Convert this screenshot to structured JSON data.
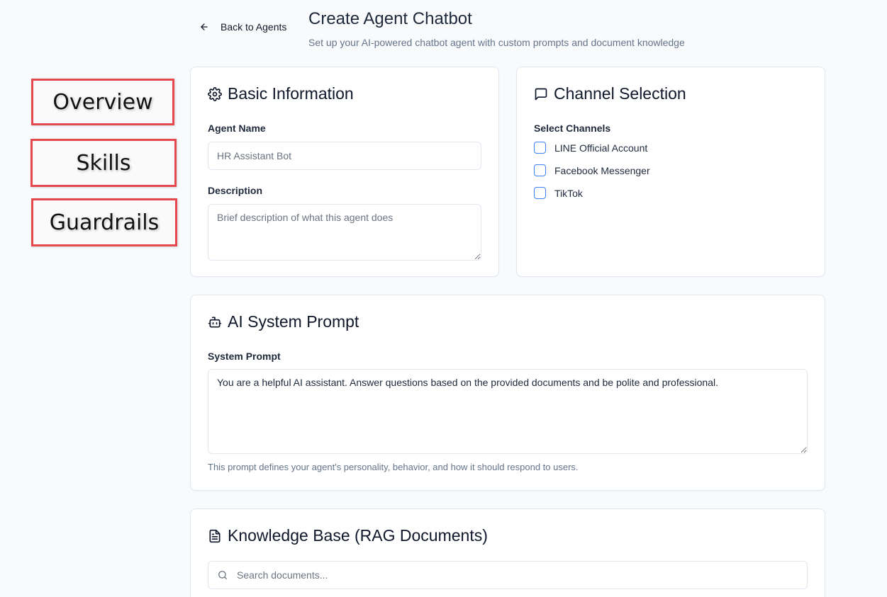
{
  "nav": {
    "overview": "Overview",
    "skills": "Skills",
    "guardrails": "Guardrails"
  },
  "header": {
    "back_label": "Back to Agents",
    "title": "Create Agent Chatbot",
    "subtitle": "Set up your AI-powered chatbot agent with custom prompts and document knowledge"
  },
  "basic_info": {
    "title": "Basic Information",
    "icon": "gear-icon",
    "agent_name_label": "Agent Name",
    "agent_name_placeholder": "HR Assistant Bot",
    "description_label": "Description",
    "description_placeholder": "Brief description of what this agent does"
  },
  "channels": {
    "title": "Channel Selection",
    "icon": "message-square-icon",
    "select_label": "Select Channels",
    "options": [
      {
        "label": "LINE Official Account",
        "checked": false
      },
      {
        "label": "Facebook Messenger",
        "checked": false
      },
      {
        "label": "TikTok",
        "checked": false
      }
    ]
  },
  "system_prompt": {
    "title": "AI System Prompt",
    "icon": "bot-icon",
    "label": "System Prompt",
    "value": "You are a helpful AI assistant. Answer questions based on the provided documents and be polite and professional.",
    "helper": "This prompt defines your agent's personality, behavior, and how it should respond to users."
  },
  "knowledge_base": {
    "title": "Knowledge Base (RAG Documents)",
    "icon": "file-text-icon",
    "search_placeholder": "Search documents..."
  },
  "colors": {
    "annotation_border": "#e5484d",
    "checkbox_border": "#3b82f6",
    "page_bg": "#f8fafc"
  }
}
